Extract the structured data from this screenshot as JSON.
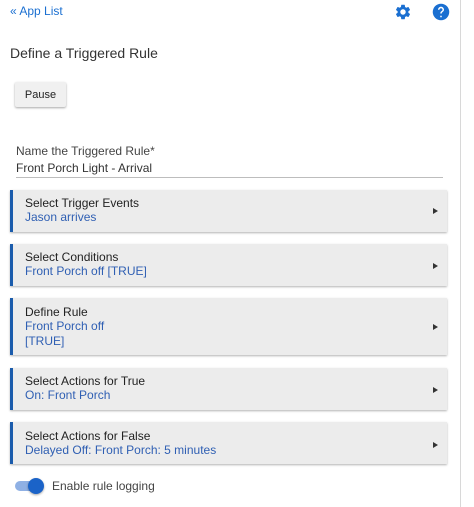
{
  "header": {
    "back_link": "« App List",
    "settings_icon": "gear-icon",
    "help_icon": "help-icon",
    "icon_color": "#1a6fd1"
  },
  "title": "Define a Triggered Rule",
  "pause_button": {
    "label": "Pause"
  },
  "name_field": {
    "label": "Name the Triggered Rule*",
    "value": "Front Porch Light - Arrival"
  },
  "sections": [
    {
      "title": "Select Trigger Events",
      "values": [
        "Jason arrives"
      ]
    },
    {
      "title": "Select Conditions",
      "values": [
        "Front Porch off [TRUE]"
      ]
    },
    {
      "title": "Define Rule",
      "values": [
        "Front Porch off",
        "[TRUE]"
      ]
    },
    {
      "title": "Select Actions for True",
      "values": [
        "On: Front Porch"
      ]
    },
    {
      "title": "Select Actions for False",
      "values": [
        "Delayed Off: Front Porch: 5 minutes"
      ]
    }
  ],
  "logging": {
    "label": "Enable rule logging",
    "enabled": true
  },
  "colors": {
    "accent": "#1b5cac",
    "value_text": "#2f5fb3",
    "section_bg": "#ececec"
  }
}
